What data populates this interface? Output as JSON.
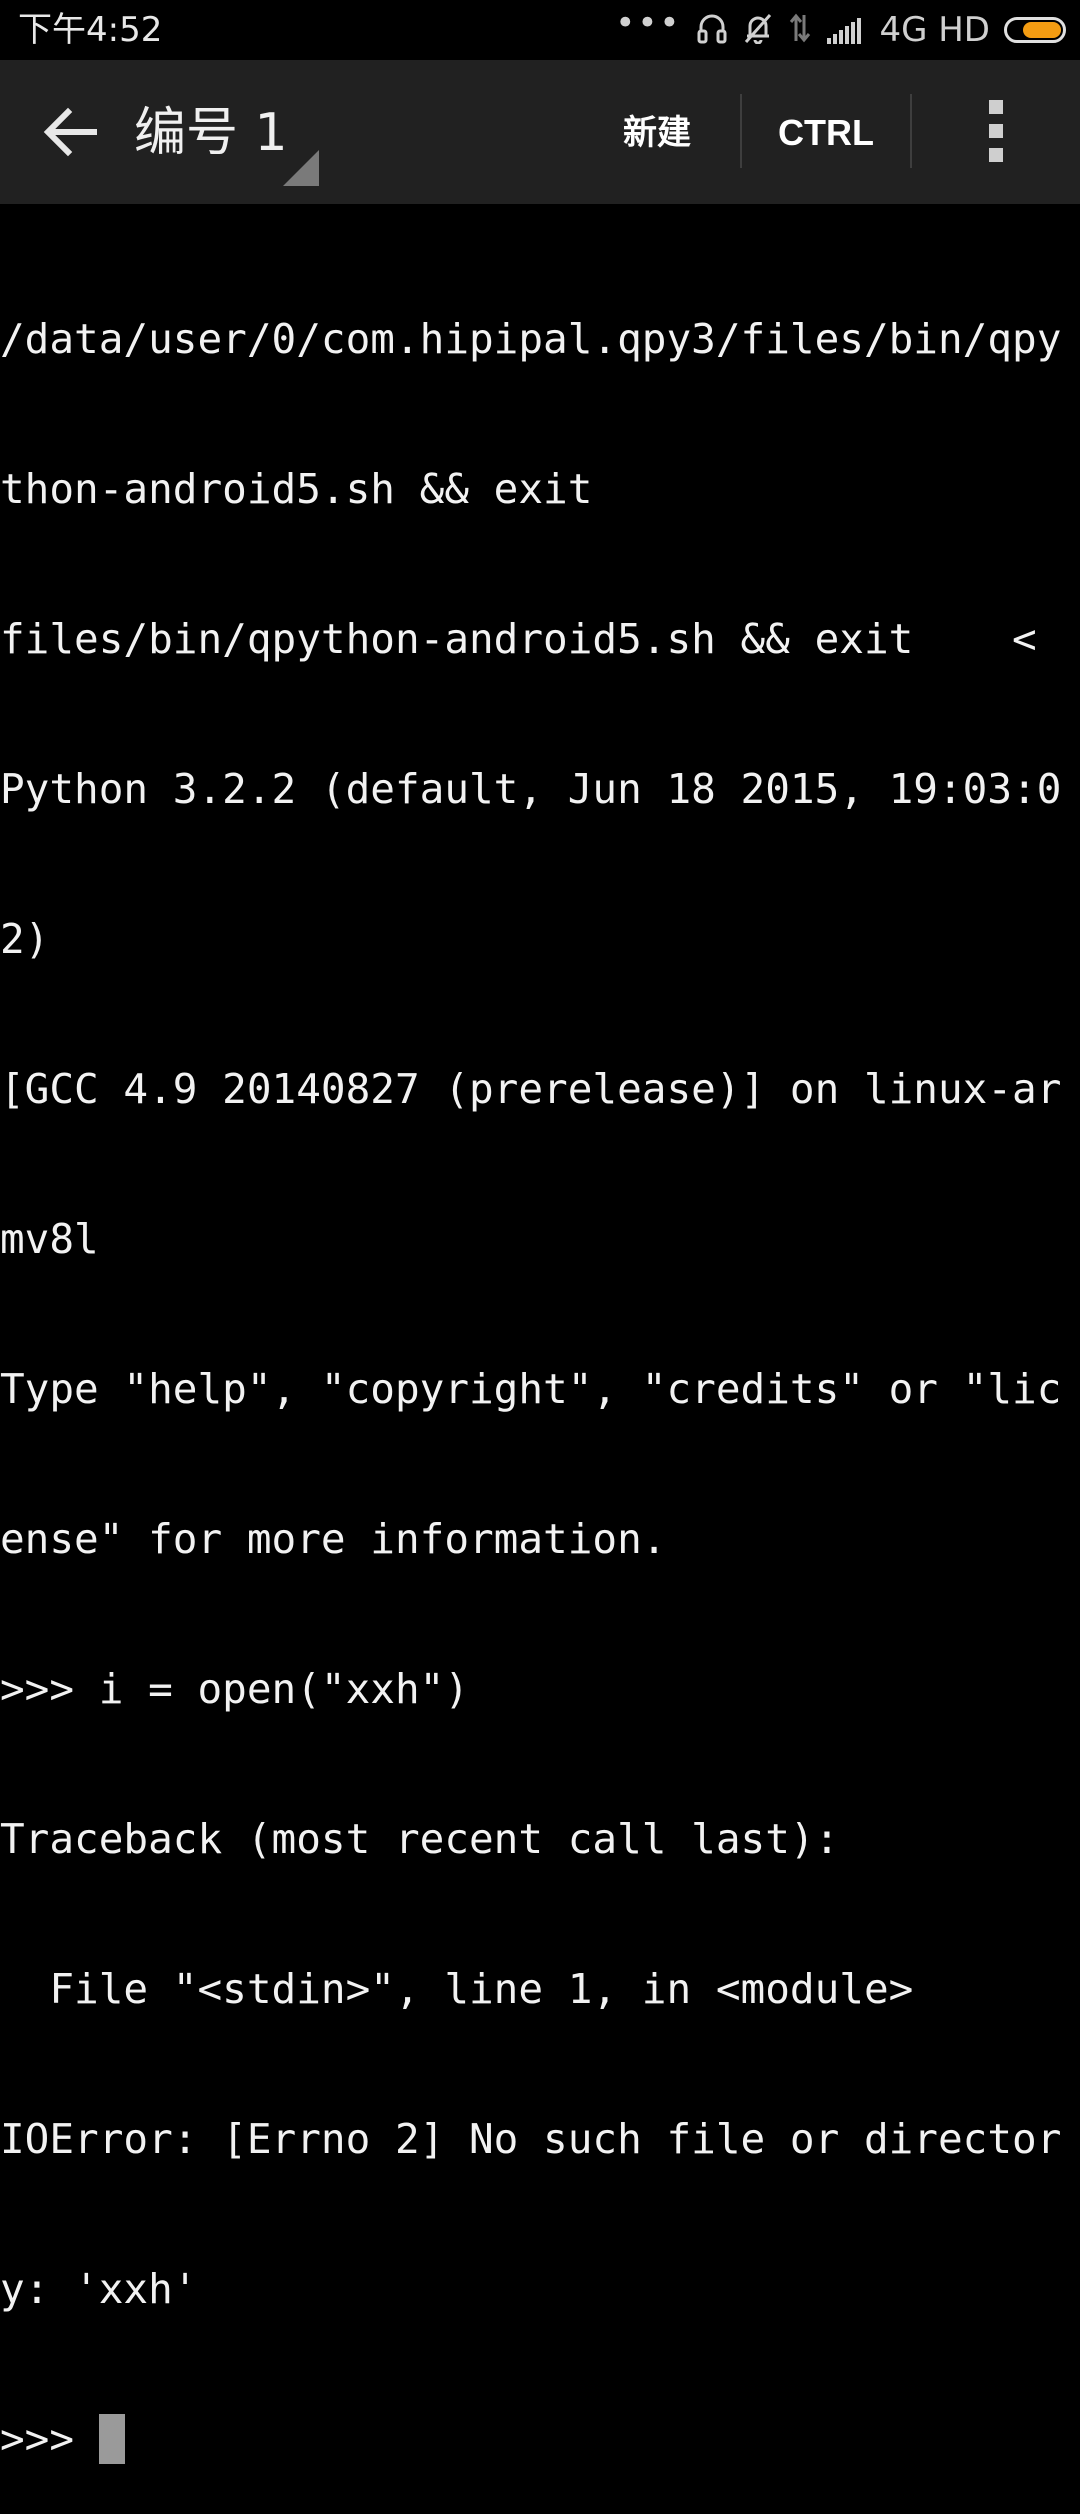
{
  "status_bar": {
    "time": "下午4:52",
    "dots": "•••",
    "network": "4G HD",
    "icons": [
      "headphones-icon",
      "bell-muted-icon",
      "data-arrows-icon",
      "signal-icon",
      "battery-icon"
    ],
    "battery_color": "#f39c12"
  },
  "app_bar": {
    "title": "编号 1",
    "new_label": "新建",
    "ctrl_label": "CTRL",
    "background": "#212121"
  },
  "terminal": {
    "lines": [
      "/data/user/0/com.hipipal.qpy3/files/bin/qpy",
      "thon-android5.sh && exit",
      "files/bin/qpython-android5.sh && exit    <",
      "Python 3.2.2 (default, Jun 18 2015, 19:03:0",
      "2)",
      "[GCC 4.9 20140827 (prerelease)] on linux-ar",
      "mv8l",
      "Type \"help\", \"copyright\", \"credits\" or \"lic",
      "ense\" for more information.",
      ">>> i = open(\"xxh\")",
      "Traceback (most recent call last):",
      "  File \"<stdin>\", line 1, in <module>",
      "IOError: [Errno 2] No such file or director",
      "y: 'xxh'"
    ],
    "prompt": ">>> "
  }
}
